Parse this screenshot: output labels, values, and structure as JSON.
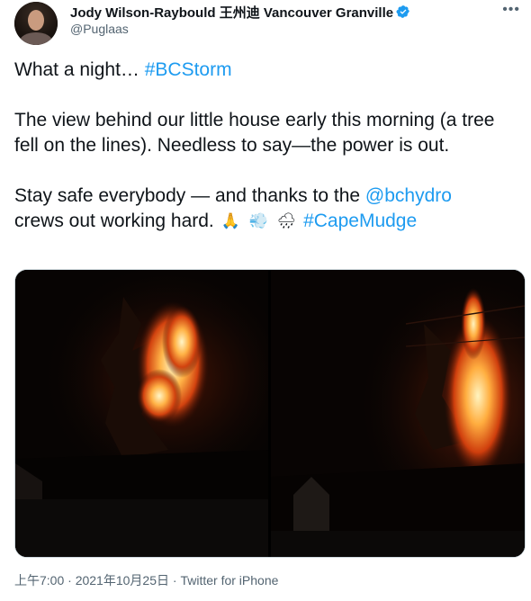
{
  "author": {
    "display_name": "Jody Wilson-Raybould 王州迪 Vancouver Granville",
    "handle": "@Puglaas",
    "verified": true
  },
  "tweet": {
    "line1_text": "What a night… ",
    "line1_hashtag": "#BCStorm",
    "paragraph2": "The view behind our little house early this morning (a tree fell on the lines). Needless to say—the power is out.",
    "line3_text": "Stay safe everybody — and thanks to the ",
    "line3_mention": "@bchydro",
    "line4_text": "crews out working hard.",
    "line4_hashtag": "#CapeMudge",
    "emojis": [
      "folded-hands-icon",
      "wind-face-icon",
      "rain-cloud-icon"
    ]
  },
  "media": {
    "count": 2,
    "photos": [
      "night-fire-tree-photo-1",
      "night-fire-tree-photo-2"
    ]
  },
  "meta": {
    "time": "上午7:00",
    "separator1": " · ",
    "date": "2021年10月25日",
    "separator2": " · ",
    "source": "Twitter for iPhone"
  },
  "colors": {
    "link": "#1d9bf0",
    "text": "#0f1419",
    "muted": "#536471",
    "verified": "#1d9bf0"
  }
}
